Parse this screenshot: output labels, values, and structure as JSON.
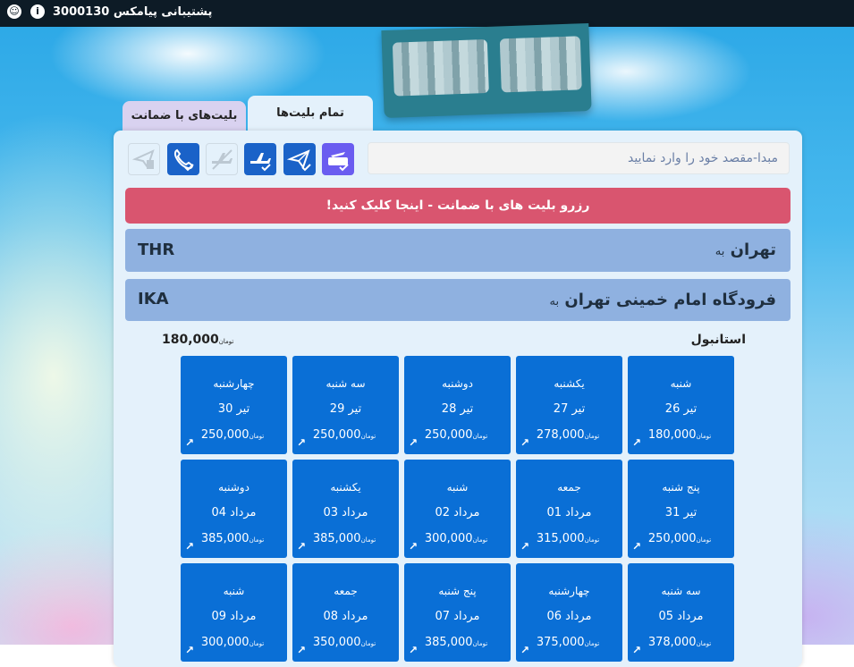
{
  "topbar": {
    "support_text": "پشتیبانی پیامکس 3000130",
    "icons": [
      "info-icon",
      "support-agent-icon"
    ]
  },
  "tabs": [
    {
      "label": "تمام بلیت‌ها",
      "active": true
    },
    {
      "label": "بلیت‌های با ضمانت",
      "active": false
    }
  ],
  "search": {
    "placeholder": "مبدا-مقصد خود را وارد نمایید",
    "value": ""
  },
  "filter_icons": [
    "ticket-plane-icon",
    "paper-plane-icon",
    "plane-check-icon",
    "plane-disabled-icon",
    "phone-check-icon",
    "plane-disabled-icon-2"
  ],
  "banner": {
    "text": "رزرو بلیت های با ضمانت - اینجا کلیک کنید!"
  },
  "routes": [
    {
      "name": "تهران",
      "suffix": "به",
      "code": "THR"
    },
    {
      "name": "فرودگاه امام خمینی تهران",
      "suffix": "به",
      "code": "IKA"
    }
  ],
  "destination": {
    "name": "استانبول",
    "min_price": "180,000",
    "currency": "تومان"
  },
  "currency": "تومان",
  "arrow": "↗",
  "days": [
    {
      "day": "شنبه",
      "date": "26 تیر",
      "price": "180,000"
    },
    {
      "day": "یکشنبه",
      "date": "27 تیر",
      "price": "278,000"
    },
    {
      "day": "دوشنبه",
      "date": "28 تیر",
      "price": "250,000"
    },
    {
      "day": "سه شنبه",
      "date": "29 تیر",
      "price": "250,000"
    },
    {
      "day": "چهارشنبه",
      "date": "30 تیر",
      "price": "250,000"
    },
    {
      "day": "پنج شنبه",
      "date": "31 تیر",
      "price": "250,000"
    },
    {
      "day": "جمعه",
      "date": "01 مرداد",
      "price": "315,000"
    },
    {
      "day": "شنبه",
      "date": "02 مرداد",
      "price": "300,000"
    },
    {
      "day": "یکشنبه",
      "date": "03 مرداد",
      "price": "385,000"
    },
    {
      "day": "دوشنبه",
      "date": "04 مرداد",
      "price": "385,000"
    },
    {
      "day": "سه شنبه",
      "date": "05 مرداد",
      "price": "378,000"
    },
    {
      "day": "چهارشنبه",
      "date": "06 مرداد",
      "price": "375,000"
    },
    {
      "day": "پنج شنبه",
      "date": "07 مرداد",
      "price": "385,000"
    },
    {
      "day": "جمعه",
      "date": "08 مرداد",
      "price": "350,000"
    },
    {
      "day": "شنبه",
      "date": "09 مرداد",
      "price": "300,000"
    }
  ],
  "colors": {
    "card": "#0a6fd6",
    "banner": "#d9556f",
    "route": "#8fb1e0",
    "topbar": "#0d1b26"
  }
}
